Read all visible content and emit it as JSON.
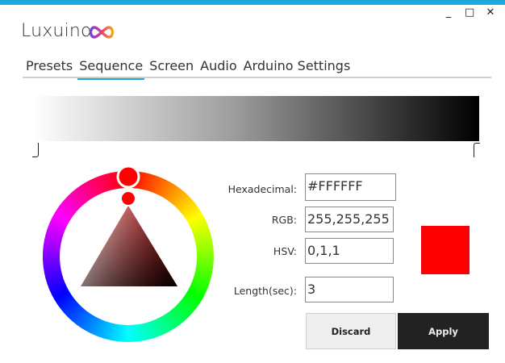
{
  "app": {
    "title": "Luxuino"
  },
  "window_controls": {
    "minimize": "_",
    "maximize": "□",
    "close": "✕"
  },
  "tabs": [
    {
      "label": "Presets",
      "active": false
    },
    {
      "label": "Sequence",
      "active": true
    },
    {
      "label": "Screen",
      "active": false
    },
    {
      "label": "Audio",
      "active": false
    },
    {
      "label": "Arduino Settings",
      "active": false
    }
  ],
  "colors": {
    "accent": "#1ca8dd",
    "selected_color": "#ff0000",
    "apply_bg": "#222222"
  },
  "picker": {
    "hex_label": "Hexadecimal:",
    "hex_value": "#FFFFFF",
    "rgb_label": "RGB:",
    "rgb_value": "255,255,255",
    "hsv_label": "HSV:",
    "hsv_value": "0,1,1",
    "length_label": "Length(sec):",
    "length_value": "3"
  },
  "actions": {
    "discard": "Discard",
    "apply": "Apply"
  },
  "icons": {
    "logo": "infinity-logo-icon",
    "gradient_handles": "gradient-stop-handle-icon"
  }
}
